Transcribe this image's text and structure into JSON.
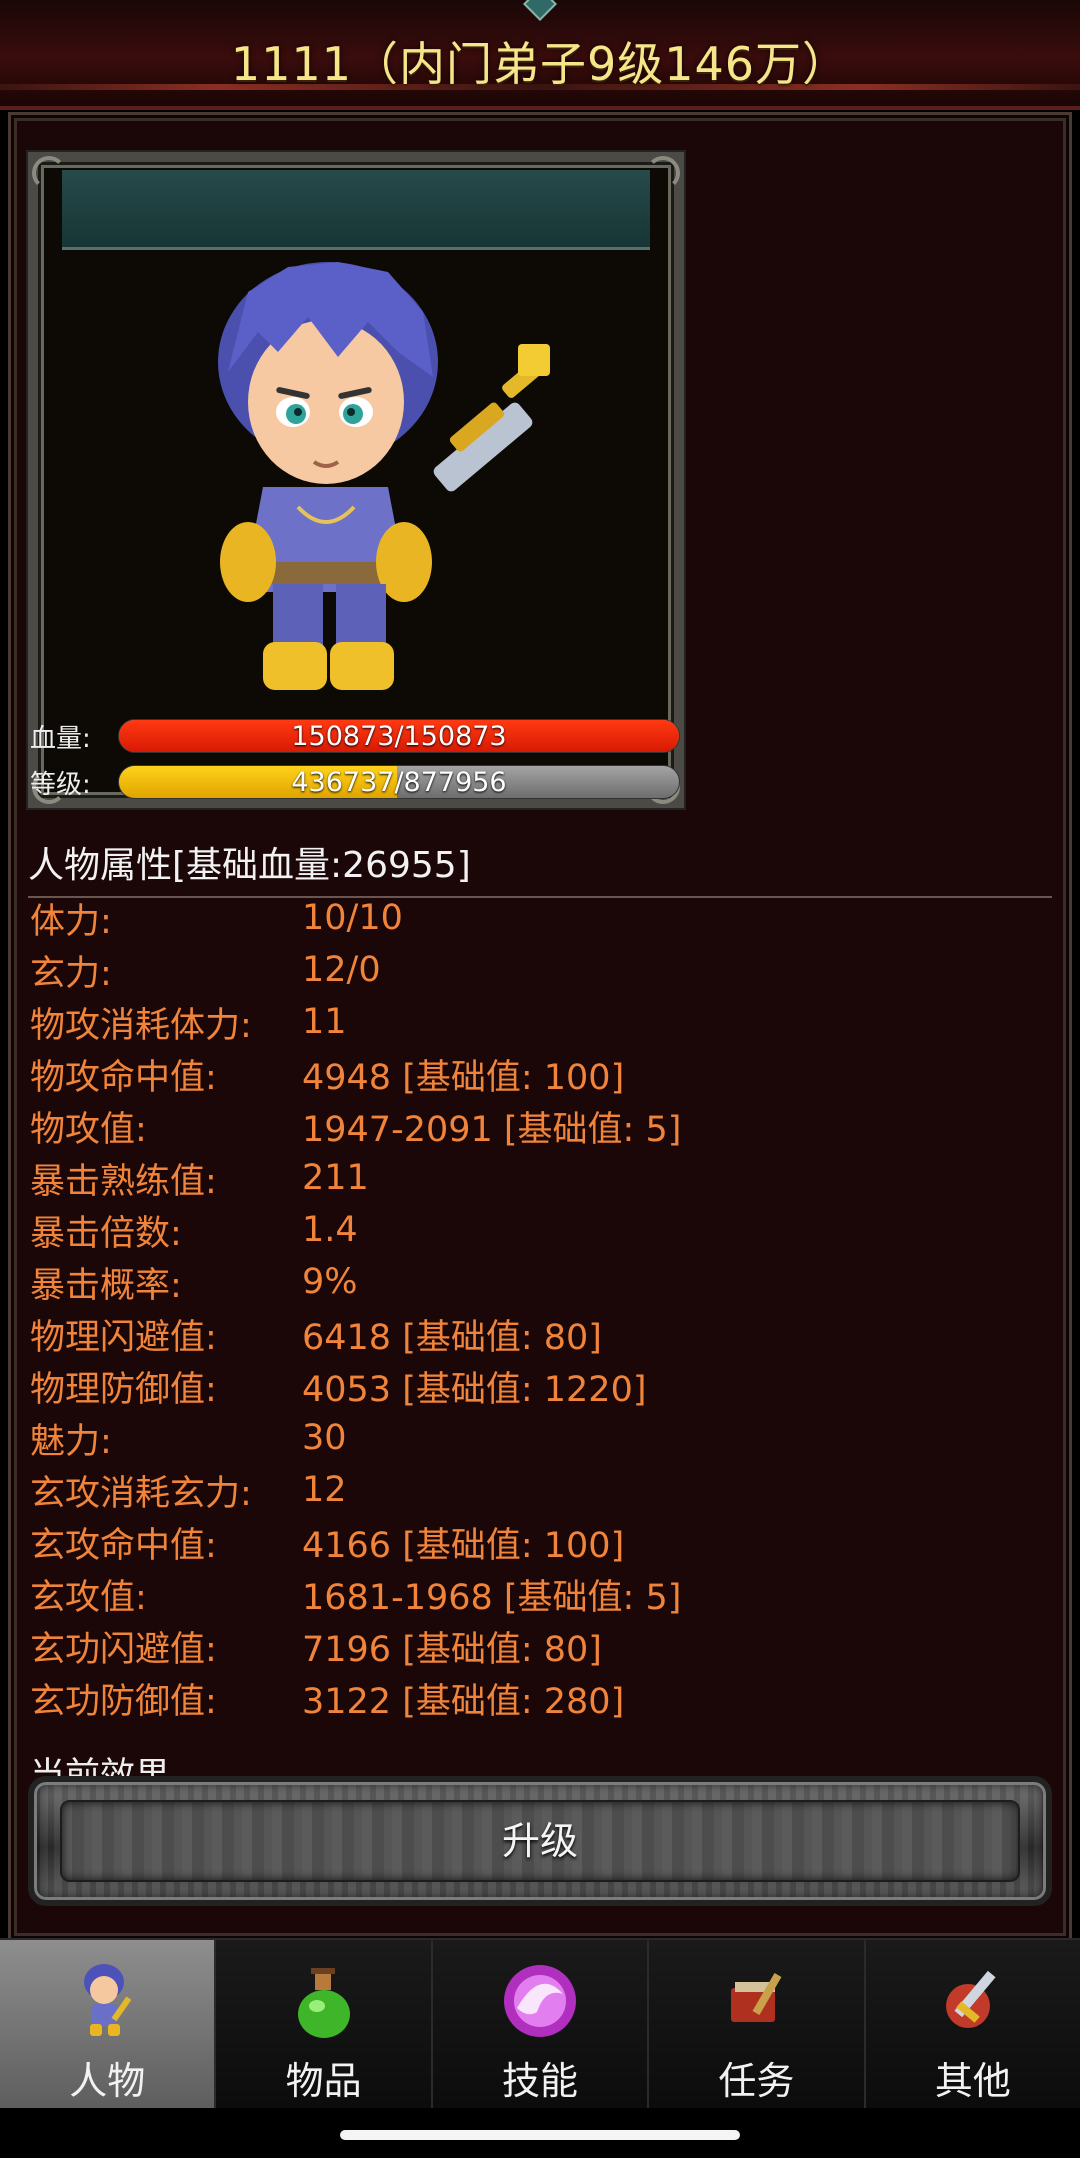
{
  "header": {
    "title": "1111（内门弟子9级146万）"
  },
  "character": {
    "hp_label": "血量:",
    "hp_text": "150873/150873",
    "hp_fraction": 1.0,
    "level_label": "等级:",
    "level_text": "436737/877956",
    "level_fraction": 0.497
  },
  "attributes": {
    "header": "人物属性[基础血量:26955]",
    "rows": [
      {
        "k": "体力:",
        "v": "10/10"
      },
      {
        "k": "玄力:",
        "v": "12/0"
      },
      {
        "k": "物攻消耗体力:",
        "v": "11"
      },
      {
        "k": "物攻命中值:",
        "v": "4948 [基础值: 100]"
      },
      {
        "k": "物攻值:",
        "v": "1947-2091 [基础值: 5]"
      },
      {
        "k": "暴击熟练值:",
        "v": "211"
      },
      {
        "k": "暴击倍数:",
        "v": "1.4"
      },
      {
        "k": "暴击概率:",
        "v": "9%"
      },
      {
        "k": "物理闪避值:",
        "v": "6418 [基础值: 80]"
      },
      {
        "k": "物理防御值:",
        "v": "4053 [基础值: 1220]"
      },
      {
        "k": "魅力:",
        "v": "30"
      },
      {
        "k": "玄攻消耗玄力:",
        "v": "12"
      },
      {
        "k": "玄攻命中值:",
        "v": "4166 [基础值: 100]"
      },
      {
        "k": "玄攻值:",
        "v": "1681-1968 [基础值: 5]"
      },
      {
        "k": "玄功闪避值:",
        "v": "7196 [基础值: 80]"
      },
      {
        "k": "玄功防御值:",
        "v": "3122 [基础值: 280]"
      }
    ],
    "cutoff_text": "当前效果"
  },
  "upgrade_button": {
    "label": "升级"
  },
  "tabs": [
    {
      "label": "人物",
      "icon": "character-icon",
      "active": true
    },
    {
      "label": "物品",
      "icon": "potion-icon",
      "active": false
    },
    {
      "label": "技能",
      "icon": "skill-orb-icon",
      "active": false
    },
    {
      "label": "任务",
      "icon": "quest-icon",
      "active": false
    },
    {
      "label": "其他",
      "icon": "sword-icon",
      "active": false
    }
  ]
}
